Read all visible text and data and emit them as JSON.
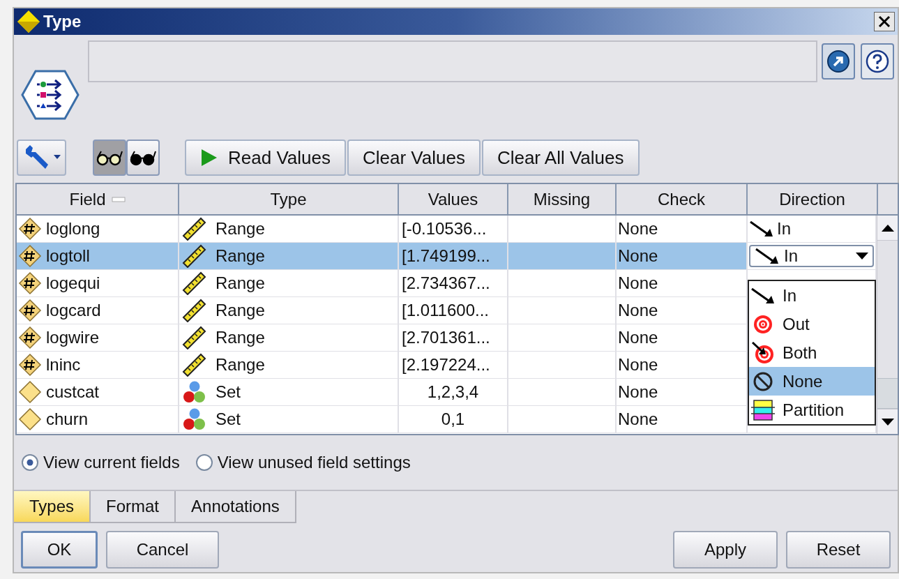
{
  "window": {
    "title": "Type"
  },
  "view_toggles": [
    {
      "selected": true
    },
    {
      "selected": false
    }
  ],
  "toolbar_buttons": [
    {
      "label": "Read Values",
      "kind": "play"
    },
    {
      "label": "Clear Values",
      "kind": "plain"
    },
    {
      "label": "Clear All Values",
      "kind": "plain"
    }
  ],
  "table": {
    "columns": [
      {
        "label": "Field",
        "sorted": true
      },
      {
        "label": "Type",
        "sorted": false
      },
      {
        "label": "Values",
        "sorted": false
      },
      {
        "label": "Missing",
        "sorted": false
      },
      {
        "label": "Check",
        "sorted": false
      },
      {
        "label": "Direction",
        "sorted": false
      }
    ],
    "rows": [
      {
        "field": "loglong",
        "kind": "range",
        "type": "Range",
        "values": "[-0.10536...",
        "check": "None",
        "direction": "In",
        "selected": false,
        "dropdown": false
      },
      {
        "field": "logtoll",
        "kind": "range",
        "type": "Range",
        "values": "[1.749199...",
        "check": "None",
        "direction": "In",
        "selected": true,
        "dropdown": true
      },
      {
        "field": "logequi",
        "kind": "range",
        "type": "Range",
        "values": "[2.734367...",
        "check": "None",
        "selected": false
      },
      {
        "field": "logcard",
        "kind": "range",
        "type": "Range",
        "values": "[1.011600...",
        "check": "None",
        "selected": false
      },
      {
        "field": "logwire",
        "kind": "range",
        "type": "Range",
        "values": "[2.701361...",
        "check": "None",
        "selected": false
      },
      {
        "field": "lninc",
        "kind": "range",
        "type": "Range",
        "values": "[2.197224...",
        "check": "None",
        "selected": false
      },
      {
        "field": "custcat",
        "kind": "set",
        "type": "Set",
        "values": "1,2,3,4",
        "check": "None",
        "selected": false
      },
      {
        "field": "churn",
        "kind": "set",
        "type": "Set",
        "values": "0,1",
        "check": "None",
        "selected": false
      }
    ]
  },
  "direction_menu": {
    "options": [
      {
        "label": "In",
        "kind": "in",
        "selected": false
      },
      {
        "label": "Out",
        "kind": "out",
        "selected": false
      },
      {
        "label": "Both",
        "kind": "both",
        "selected": false
      },
      {
        "label": "None",
        "kind": "none",
        "selected": true
      },
      {
        "label": "Partition",
        "kind": "partition",
        "selected": false
      }
    ]
  },
  "view_options": [
    {
      "label": "View current fields",
      "selected": true
    },
    {
      "label": "View unused field settings",
      "selected": false
    }
  ],
  "tabs": [
    {
      "label": "Types",
      "selected": true
    },
    {
      "label": "Format",
      "selected": false
    },
    {
      "label": "Annotations",
      "selected": false
    }
  ],
  "left_buttons": [
    {
      "label": "OK",
      "focused": true
    },
    {
      "label": "Cancel",
      "focused": false
    }
  ],
  "right_buttons": [
    {
      "label": "Apply"
    },
    {
      "label": "Reset"
    }
  ]
}
